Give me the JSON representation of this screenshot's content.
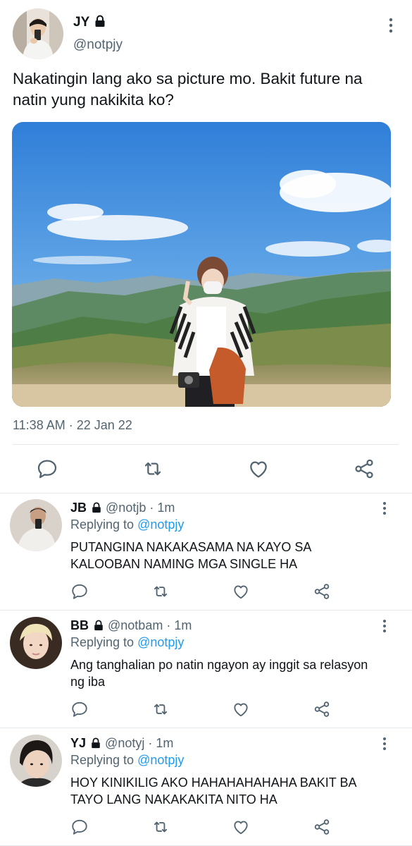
{
  "main_tweet": {
    "author_name": "JY",
    "author_handle": "@notpjy",
    "text": "Nakatingin lang ako sa picture mo. Bakit future na natin yung nakikita ko?",
    "timestamp": "11:38 AM · 22 Jan 22",
    "icons": [
      "lock-icon",
      "more-icon",
      "reply-icon",
      "retweet-icon",
      "like-icon",
      "share-icon"
    ]
  },
  "replies": [
    {
      "name": "JB",
      "handle": "@notjb",
      "time": "1m",
      "replying_label": "Replying to",
      "replying_to": "@notpjy",
      "text": "PUTANGINA NAKAKASAMA NA KAYO SA KALOOBAN NAMING MGA SINGLE HA"
    },
    {
      "name": "BB",
      "handle": "@notbam",
      "time": "1m",
      "replying_label": "Replying to",
      "replying_to": "@notpjy",
      "text": "Ang tanghalian po natin ngayon ay inggit sa relasyon ng iba"
    },
    {
      "name": "YJ",
      "handle": "@notyj",
      "time": "1m",
      "replying_label": "Replying to",
      "replying_to": "@notpjy",
      "text": "HOY KINIKILIG AKO HAHAHAHAHAHA BAKIT BA TAYO LANG NAKAKAKITA NITO HA"
    }
  ],
  "colors": {
    "text_primary": "#0f1419",
    "text_secondary": "#536471",
    "link": "#1d9bf0",
    "divider": "#e6e9ec"
  }
}
